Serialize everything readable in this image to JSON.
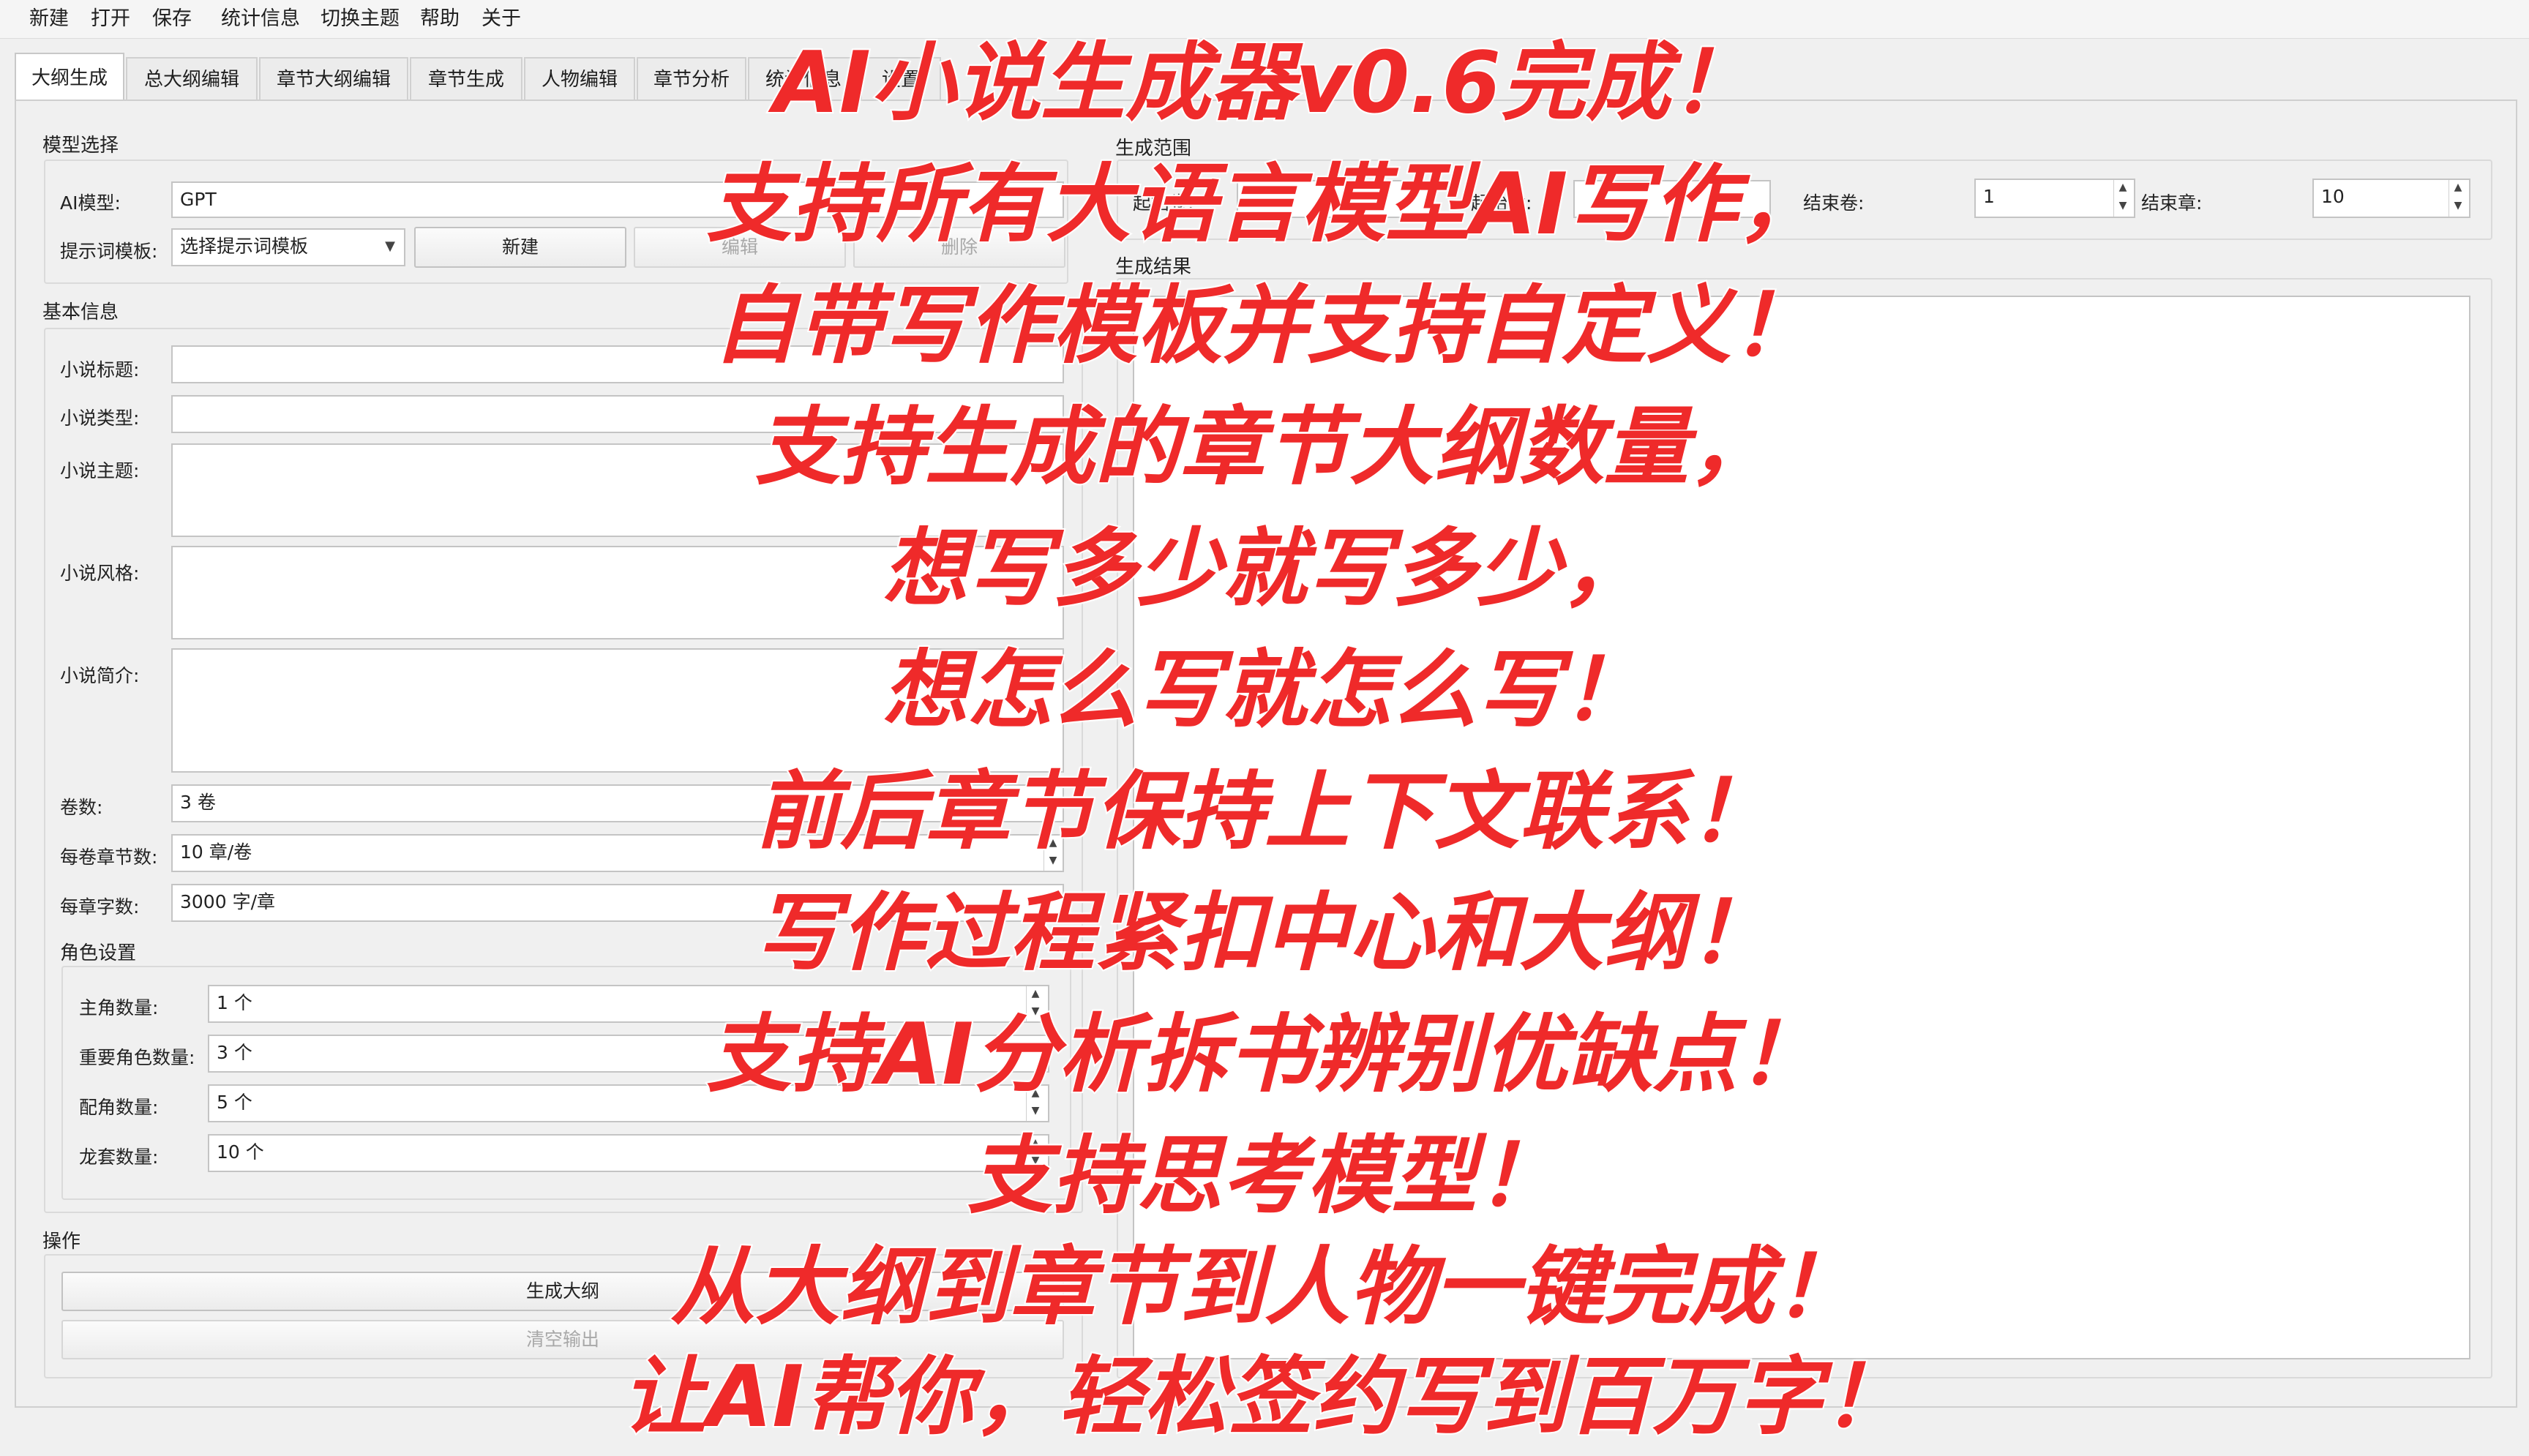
{
  "menu": [
    "新建",
    "打开",
    "保存",
    "统计信息",
    "切换主题",
    "帮助",
    "关于"
  ],
  "tabs": [
    "大纲生成",
    "总大纲编辑",
    "章节大纲编辑",
    "章节生成",
    "人物编辑",
    "章节分析",
    "统计信息",
    "设置"
  ],
  "model_section": {
    "title": "模型选择",
    "ai_model_label": "AI模型:",
    "ai_model_value": "GPT",
    "prompt_template_label": "提示词模板:",
    "prompt_template_value": "选择提示词模板",
    "new_button": "新建",
    "edit_button": "编辑",
    "delete_button": "删除"
  },
  "basic_info": {
    "title": "基本信息",
    "novel_title_label": "小说标题:",
    "novel_type_label": "小说类型:",
    "novel_theme_label": "小说主题:",
    "novel_style_label": "小说风格:",
    "novel_intro_label": "小说简介:",
    "volumes_label": "卷数:",
    "volumes_value": "3 卷",
    "chapters_per_volume_label": "每卷章节数:",
    "chapters_per_volume_value": "10 章/卷",
    "words_per_chapter_label": "每章字数:",
    "words_per_chapter_value": "3000 字/章"
  },
  "characters": {
    "title": "角色设置",
    "protagonists_label": "主角数量:",
    "protagonists_value": "1 个",
    "important_label": "重要角色数量:",
    "important_value": "3 个",
    "supporting_label": "配角数量:",
    "supporting_value": "5 个",
    "extras_label": "龙套数量:",
    "extras_value": "10 个"
  },
  "operations": {
    "title": "操作",
    "generate_button": "生成大纲",
    "clear_button": "清空输出"
  },
  "range": {
    "title": "生成范围",
    "start_volume_label": "起始卷:",
    "start_chapter_label": "起始章:",
    "end_volume_label": "结束卷:",
    "end_volume_value": "1",
    "end_chapter_label": "结束章:",
    "end_chapter_value": "10"
  },
  "result": {
    "title": "生成结果"
  },
  "overlay": [
    "AI小说生成器v0.6完成！",
    "支持所有大语言模型AI写作，",
    "自带写作模板并支持自定义！",
    "支持生成的章节大纲数量，",
    "想写多少就写多少，",
    "想怎么写就怎么写！",
    "前后章节保持上下文联系！",
    "写作过程紧扣中心和大纲！",
    "支持AI分析拆书辨别优缺点！",
    "支持思考模型！",
    "从大纲到章节到人物一键完成！",
    "让AI帮你，轻松签约写到百万字！"
  ],
  "colors": {
    "overlay_text": "#ef2a2a",
    "overlay_outline": "#ffffff"
  }
}
